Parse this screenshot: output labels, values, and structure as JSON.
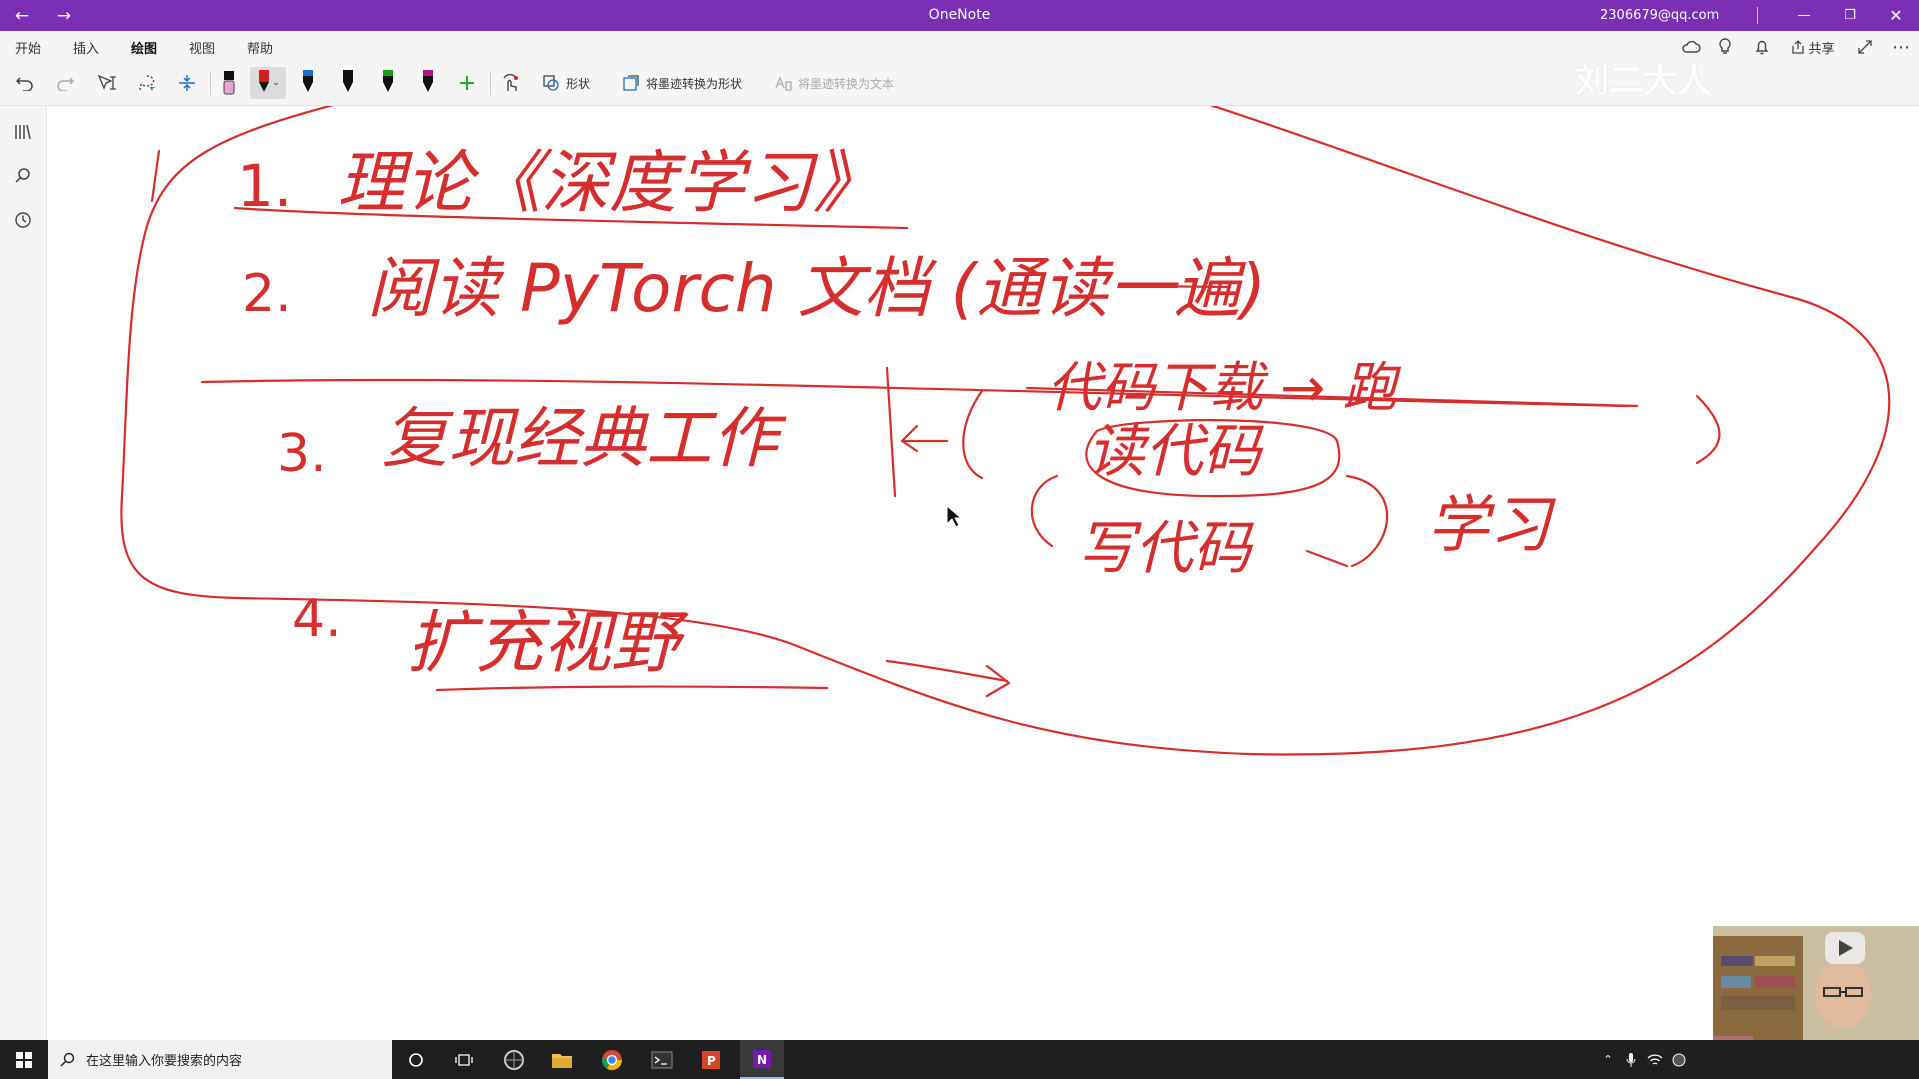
{
  "window": {
    "title": "OneNote",
    "account": "2306679@qq.com",
    "back_icon": "arrow-left-icon",
    "forward_icon": "arrow-right-icon"
  },
  "ribbon": {
    "tabs": [
      {
        "label": "开始"
      },
      {
        "label": "插入"
      },
      {
        "label": "绘图",
        "active": true
      },
      {
        "label": "视图"
      },
      {
        "label": "帮助"
      }
    ],
    "share_label": "共享",
    "shapes_label": "形状",
    "ink_to_shape_label": "将墨迹转换为形状",
    "ink_to_text_label": "将墨迹转换为文本",
    "pen_colors": [
      "#111111",
      "#d62020",
      "#111111",
      "#111111",
      "#1a9e1a",
      "#b0168c"
    ],
    "highlighter_color": "#e9a3d8"
  },
  "notes": {
    "item1_number": "1.",
    "item1_text": "理论《深度学习》",
    "item2_number": "2.",
    "item2_text": "阅读 PyTorch 文档 (通读一遍)",
    "item3_number": "3.",
    "item3_text": "复现经典工作",
    "item3_branch_top": "代码下载 → 跑",
    "item3_branch_read": "读代码",
    "item3_branch_write": "写代码",
    "item3_learn": "学习",
    "item4_number": "4.",
    "item4_text": "扩充视野"
  },
  "watermark": "刘二大人",
  "taskbar": {
    "search_placeholder": "在这里输入你要搜索的内容"
  },
  "colors": {
    "accent": "#7b2fb4",
    "ink": "#d62d2d"
  }
}
